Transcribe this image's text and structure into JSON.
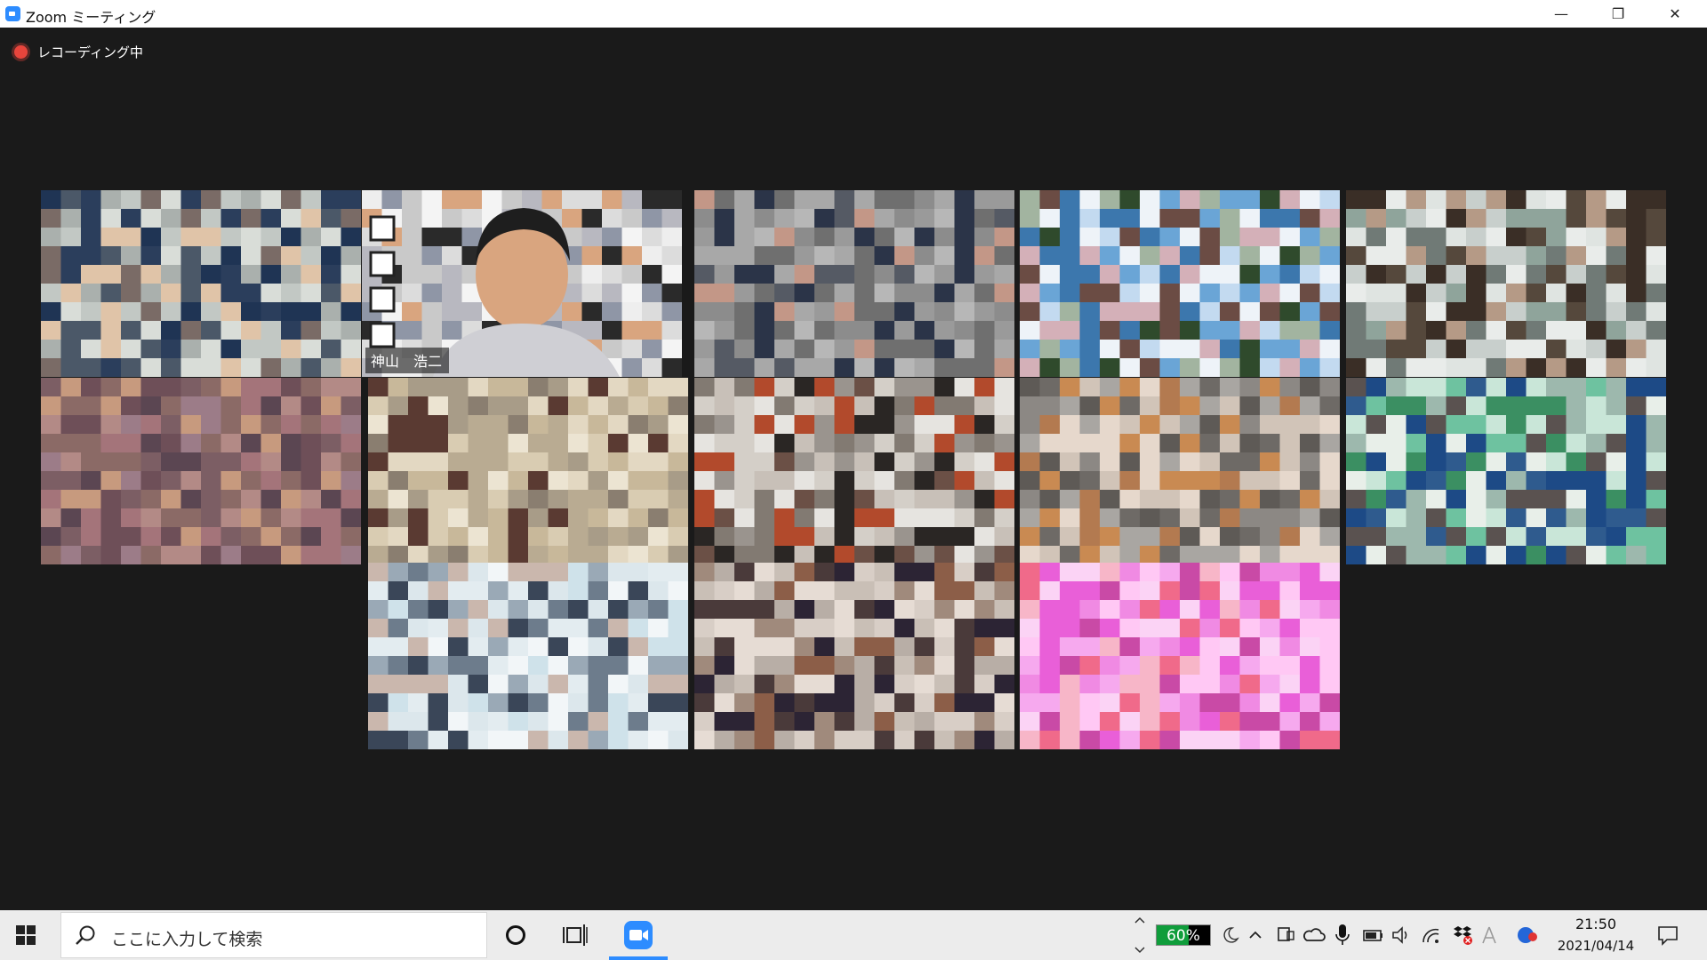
{
  "window": {
    "title": "Zoom ミーティング",
    "minimize_glyph": "—",
    "restore_glyph": "❐",
    "close_glyph": "✕"
  },
  "recording": {
    "label": "レコーディング中"
  },
  "gallery": {
    "active_speaker_name": "神山　浩二",
    "highlight_color": "#d6e56b",
    "tiles": [
      {
        "id": "p01",
        "palette": [
          "#d9ddd8",
          "#c2c8c4",
          "#2b3e5c",
          "#1f3454",
          "#aab0ad",
          "#7a6b66",
          "#e0c4a8",
          "#4b5868"
        ]
      },
      {
        "id": "active",
        "palette": [
          "#f4f4f4",
          "#dcdcdc",
          "#b8b8c0",
          "#d9a57f",
          "#2a2a2a",
          "#c9c9c9",
          "#8f96a6",
          "#eeeeee"
        ]
      },
      {
        "id": "p03",
        "palette": [
          "#a8a8a8",
          "#8c8c8c",
          "#b7b7b7",
          "#c39787",
          "#2b3448",
          "#6f6f6f",
          "#9a9a9a",
          "#555a64"
        ]
      },
      {
        "id": "p04",
        "palette": [
          "#eef3f8",
          "#c3daf0",
          "#6aa5d6",
          "#3c77ad",
          "#6b4c44",
          "#d4b0b8",
          "#2f4a2c",
          "#a2b4a0"
        ]
      },
      {
        "id": "p05",
        "palette": [
          "#dfe4e1",
          "#c8cfcc",
          "#55483c",
          "#3a2e26",
          "#b59a86",
          "#8fa49b",
          "#e9ecea",
          "#707a76"
        ]
      },
      {
        "id": "p06",
        "palette": [
          "#8b6a66",
          "#6e4f58",
          "#c79a7e",
          "#a4747a",
          "#5b4652",
          "#b38a86",
          "#9c7c88",
          "#7c5e64"
        ]
      },
      {
        "id": "p07",
        "palette": [
          "#d9ccb2",
          "#c8b89a",
          "#ece4d2",
          "#5a3a32",
          "#a89c88",
          "#8a7e70",
          "#b9ab92",
          "#e3d8c2"
        ]
      },
      {
        "id": "p08",
        "palette": [
          "#c8c0b8",
          "#b24a2c",
          "#e6e4e0",
          "#6b5046",
          "#9a948e",
          "#2a2624",
          "#d4cfc8",
          "#827a72"
        ]
      },
      {
        "id": "p09",
        "palette": [
          "#a9a6a2",
          "#e6d8cc",
          "#c98a52",
          "#5e5a56",
          "#8c8884",
          "#d1c4b8",
          "#b37a50",
          "#6e6a66"
        ]
      },
      {
        "id": "p10",
        "palette": [
          "#6ec2a0",
          "#c9e6d8",
          "#2f5b8e",
          "#3b8f62",
          "#e8efe9",
          "#9db8ad",
          "#1d4a86",
          "#5a5250"
        ]
      },
      {
        "id": "p11",
        "palette": [
          "#e3ecf0",
          "#cfe2ea",
          "#f2f6f8",
          "#cab7ad",
          "#3a4658",
          "#9aa9b6",
          "#dce7ec",
          "#6d7c8c"
        ]
      },
      {
        "id": "p12",
        "palette": [
          "#d8cec6",
          "#e6dcd4",
          "#4a3a3a",
          "#8c5e48",
          "#b8aea6",
          "#c9bfb6",
          "#2c2434",
          "#a08a7c"
        ]
      },
      {
        "id": "p13",
        "palette": [
          "#f6a9ee",
          "#f08ae3",
          "#ffc8f4",
          "#f06a8a",
          "#e95fd8",
          "#fbd3f5",
          "#c94aa6",
          "#f7b6c8"
        ]
      }
    ]
  },
  "taskbar": {
    "search_placeholder": "ここに入力して検索",
    "battery_percent": 60,
    "battery_label": "60%",
    "time": "21:50",
    "date": "2021/04/14",
    "icons": [
      "windows-start-icon",
      "search-icon",
      "cortana-icon",
      "task-view-icon",
      "zoom-app-icon",
      "chevron-up-icon",
      "network-icon",
      "onedrive-icon",
      "microphone-icon",
      "battery-icon",
      "speaker-icon",
      "wifi-icon",
      "dropbox-icon",
      "ime-icon",
      "notification-icon"
    ]
  }
}
